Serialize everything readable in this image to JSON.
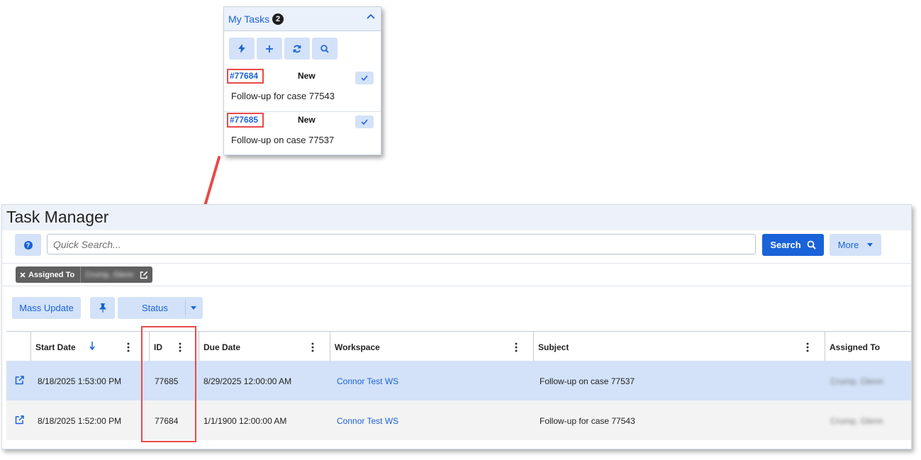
{
  "my_tasks": {
    "title": "My Tasks",
    "count": "2",
    "tools": [
      "bolt-icon",
      "plus-icon",
      "refresh-icon",
      "search-icon"
    ],
    "items": [
      {
        "id": "#77684",
        "status": "New",
        "subject": "Follow-up for case 77543"
      },
      {
        "id": "#77685",
        "status": "New",
        "subject": "Follow-up on case 77537"
      }
    ]
  },
  "task_manager": {
    "title": "Task Manager",
    "search": {
      "placeholder": "Quick Search...",
      "button_label": "Search"
    },
    "more_label": "More",
    "filter_chip": {
      "label": "Assigned To",
      "value": "Crump, Glenn"
    },
    "toolbar": {
      "mass_update_label": "Mass Update",
      "status_label": "Status"
    },
    "table": {
      "columns": [
        "Start Date",
        "ID",
        "Due Date",
        "Workspace",
        "Subject",
        "Assigned To"
      ],
      "rows": [
        {
          "start_date": "8/18/2025 1:53:00 PM",
          "id": "77685",
          "due_date": "8/29/2025 12:00:00 AM",
          "workspace": "Connor Test WS",
          "subject": "Follow-up on case 77537",
          "assigned_to": "Crump, Glenn"
        },
        {
          "start_date": "8/18/2025 1:52:00 PM",
          "id": "77684",
          "due_date": "1/1/1900 12:00:00 AM",
          "workspace": "Connor Test WS",
          "subject": "Follow-up for case 77543",
          "assigned_to": "Crump, Glenn"
        }
      ]
    }
  },
  "colors": {
    "accent": "#1a62d8",
    "button_light": "#d3e2f8",
    "highlight": "#e84a4a",
    "selected_row": "#d3e2f8"
  }
}
